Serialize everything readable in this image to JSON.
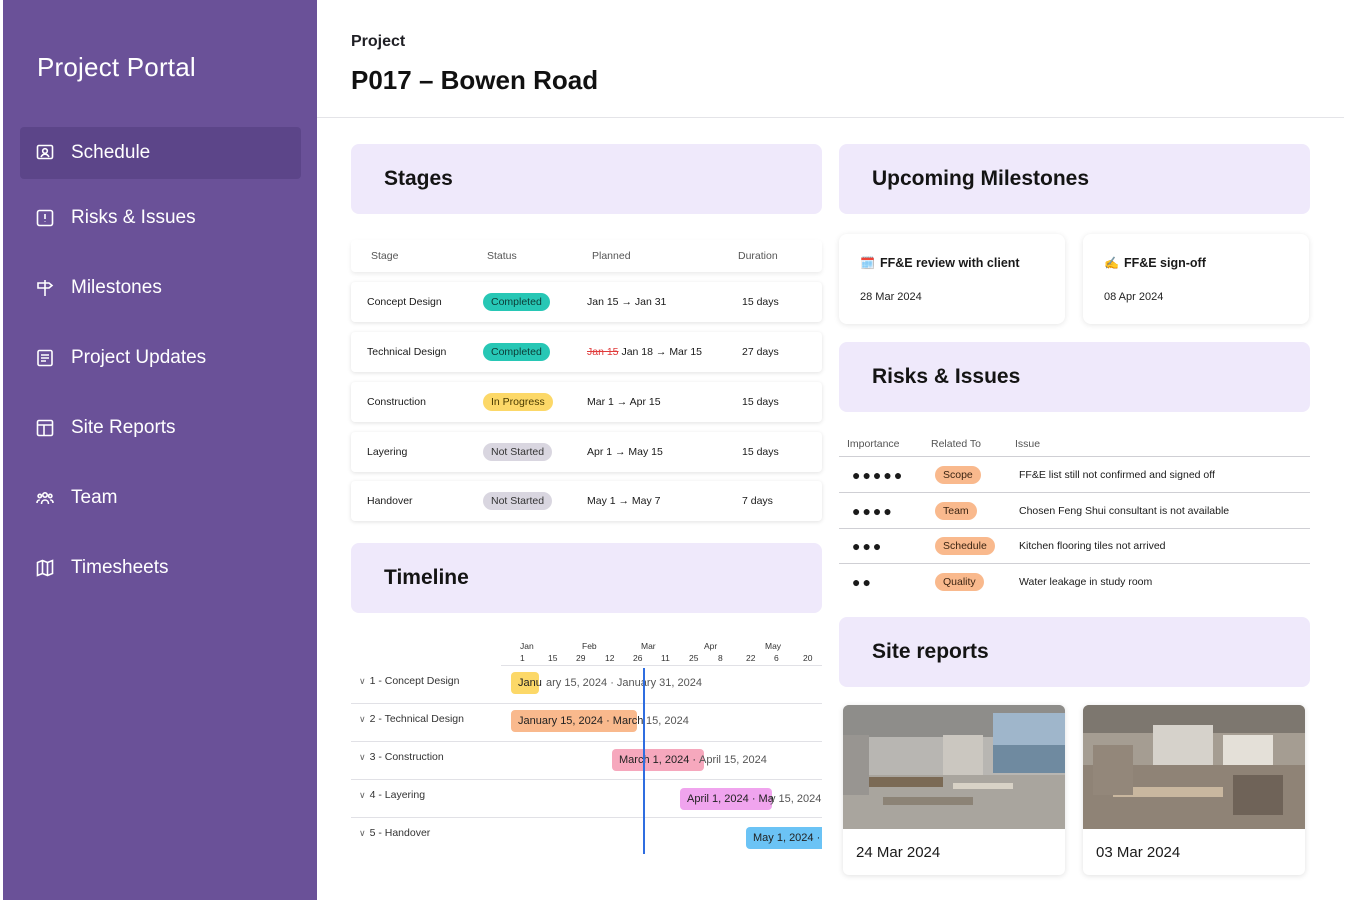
{
  "sidebar": {
    "brand": "Project Portal",
    "items": [
      {
        "label": "Schedule",
        "icon": "schedule-icon"
      },
      {
        "label": "Risks & Issues",
        "icon": "alert-icon"
      },
      {
        "label": "Milestones",
        "icon": "signpost-icon"
      },
      {
        "label": "Project Updates",
        "icon": "document-icon"
      },
      {
        "label": "Site Reports",
        "icon": "layout-icon"
      },
      {
        "label": "Team",
        "icon": "team-icon"
      },
      {
        "label": "Timesheets",
        "icon": "map-icon"
      }
    ]
  },
  "header": {
    "crumb": "Project",
    "title": "P017 – Bowen Road"
  },
  "stages": {
    "title": "Stages",
    "columns": [
      "Stage",
      "Status",
      "Planned",
      "Duration"
    ],
    "rows": [
      {
        "stage": "Concept Design",
        "status": "Completed",
        "planned": "Jan 15 → Jan 31",
        "duration": "15 days"
      },
      {
        "stage": "Technical Design",
        "status": "Completed",
        "planned_old": "Jan 15",
        "planned": "Jan 18 → Mar 15",
        "duration": "27 days"
      },
      {
        "stage": "Construction",
        "status": "In Progress",
        "planned": "Mar 1 → Apr 15",
        "duration": "15 days"
      },
      {
        "stage": "Layering",
        "status": "Not Started",
        "planned": "Apr 1 → May 15",
        "duration": "15 days"
      },
      {
        "stage": "Handover",
        "status": "Not Started",
        "planned": "May 1 → May 7",
        "duration": "7 days"
      }
    ]
  },
  "milestones": {
    "title": "Upcoming Milestones",
    "cards": [
      {
        "emoji": "🗓️",
        "title": "FF&E review with client",
        "date": "28 Mar 2024"
      },
      {
        "emoji": "✍️",
        "title": "FF&E sign-off",
        "date": "08 Apr 2024"
      }
    ]
  },
  "risks": {
    "title": "Risks & Issues",
    "columns": [
      "Importance",
      "Related To",
      "Issue"
    ],
    "rows": [
      {
        "importance": "●●●●●",
        "related": "Scope",
        "issue": "FF&E list still not confirmed and signed off"
      },
      {
        "importance": "●●●●",
        "related": "Team",
        "issue": "Chosen Feng Shui consultant is not available"
      },
      {
        "importance": "●●●",
        "related": "Schedule",
        "issue": "Kitchen flooring tiles not arrived"
      },
      {
        "importance": "●●",
        "related": "Quality",
        "issue": "Water leakage in study room"
      }
    ]
  },
  "timeline": {
    "title": "Timeline",
    "months": [
      "Jan",
      "Feb",
      "Mar",
      "Apr",
      "May"
    ],
    "days": [
      "1",
      "15",
      "29",
      "12",
      "26",
      "11",
      "25",
      "8",
      "22",
      "6",
      "20"
    ],
    "rows": [
      {
        "label": "1 -  Concept Design",
        "bar_text": "Janu",
        "ext_text": "ary 15, 2024 · January 31, 2024",
        "color": "#fcd868"
      },
      {
        "label": "2 - Technical Design",
        "bar_text": "January 15, 2024 · March",
        "ext_text": " 15, 2024",
        "color": "#f9b98d"
      },
      {
        "label": "3 - Construction",
        "bar_text": "March 1, 2024 · ",
        "ext_text": "April 15, 2024",
        "color": "#f6a8bd"
      },
      {
        "label": "4 - Layering",
        "bar_text": "April 1, 2024 · Ma",
        "ext_text": "y 15, 2024",
        "color": "#f0a4ee"
      },
      {
        "label": "5 - Handover",
        "bar_text": "May 1, 2024 ·",
        "ext_text": "",
        "color": "#6bc3f5"
      }
    ]
  },
  "site_reports": {
    "title": "Site reports",
    "cards": [
      {
        "date": "24 Mar 2024"
      },
      {
        "date": "03 Mar 2024"
      }
    ]
  },
  "colors": {
    "sidebar": "#6a5198",
    "sidebar_active": "#5c4589",
    "section_bg": "#efe9fb",
    "today_line": "#2f6de0"
  }
}
